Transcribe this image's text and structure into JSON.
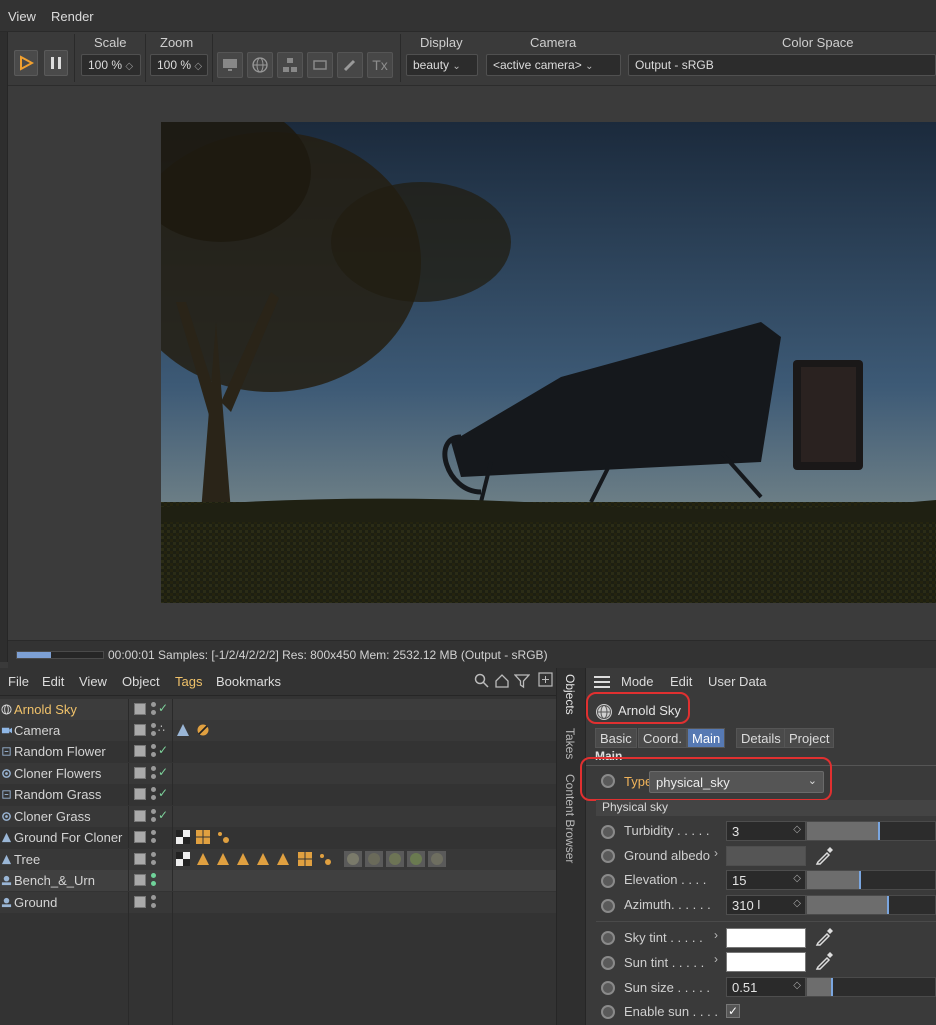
{
  "menubar": {
    "items": [
      "View",
      "Render"
    ]
  },
  "toolbar": {
    "scale_label": "Scale",
    "scale_value": "100 %",
    "zoom_label": "Zoom",
    "zoom_value": "100 %",
    "tx_label": "Tx",
    "display_label": "Display",
    "display_value": "beauty",
    "camera_label": "Camera",
    "camera_value": "<active camera>",
    "colorspace_label": "Color Space",
    "colorspace_value": "Output - sRGB",
    "play_color": "#f0a030"
  },
  "status": {
    "text": "00:00:01  Samples: [-1/2/4/2/2/2]  Res: 800x450  Mem: 2532.12 MB  (Output - sRGB)",
    "progress": 0.4
  },
  "objects": {
    "menu": [
      "File",
      "Edit",
      "View",
      "Object",
      "Tags",
      "Bookmarks"
    ],
    "rows": [
      {
        "name": "Arnold Sky",
        "selected": true
      },
      {
        "name": "Camera"
      },
      {
        "name": "Random Flower"
      },
      {
        "name": "Cloner Flowers"
      },
      {
        "name": "Random Grass"
      },
      {
        "name": "Cloner Grass"
      },
      {
        "name": "Ground For Cloner"
      },
      {
        "name": "Tree"
      },
      {
        "name": "Bench_&_Urn"
      },
      {
        "name": "Ground"
      }
    ]
  },
  "side_tabs": [
    "Objects",
    "Takes",
    "Content Browser"
  ],
  "attributes": {
    "menu": [
      "Mode",
      "Edit",
      "User Data"
    ],
    "object_name": "Arnold Sky",
    "tabs": [
      "Basic",
      "Coord.",
      "Main",
      "Details",
      "Project"
    ],
    "active_tab": "Main",
    "section_main": "Main",
    "type_label": "Type",
    "type_value": "physical_sky",
    "section_physical": "Physical sky",
    "params": {
      "turbidity": {
        "label": "Turbidity . . . . .",
        "value": "3",
        "fraction": 0.57
      },
      "ground_albedo": {
        "label": "Ground albedo"
      },
      "elevation": {
        "label": "Elevation . . . .",
        "value": "15",
        "fraction": 0.42
      },
      "azimuth": {
        "label": "Azimuth. . . . . .",
        "value": "310",
        "fraction": 0.64
      },
      "sky_tint": {
        "label": "Sky tint . . . . ."
      },
      "sun_tint": {
        "label": "Sun tint . . . . ."
      },
      "sun_size": {
        "label": "Sun size . . . . .",
        "value": "0.51",
        "fraction": 0.2
      },
      "enable_sun": {
        "label": "Enable sun . . . .",
        "checked": true
      }
    },
    "highlight_color": "#e03030",
    "accent_color": "#5679b3"
  }
}
